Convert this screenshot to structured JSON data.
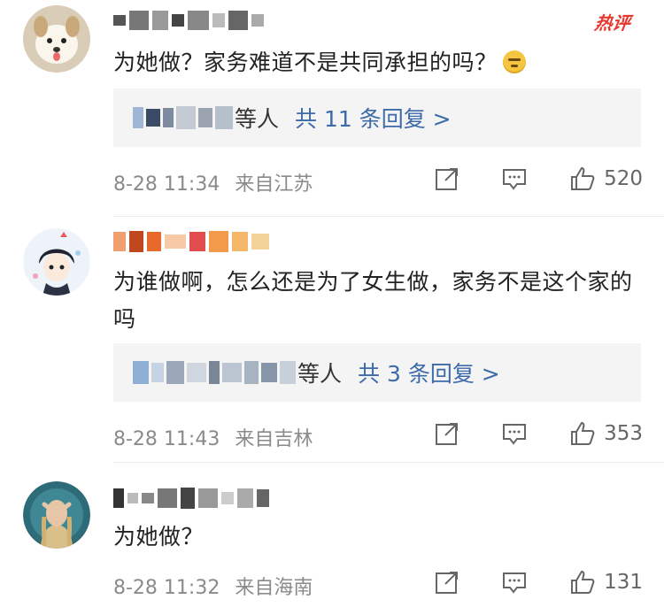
{
  "hot_badge": "热评",
  "comments": [
    {
      "text": "为她做？家务难道不是共同承担的吗？",
      "reply_who": "等人",
      "reply_link": "共 11 条回复 >",
      "time": "8-28 11:34",
      "source": "来自江苏",
      "likes": "520",
      "has_emoji": true,
      "emoji_name": "speechless-emoji"
    },
    {
      "text": "为谁做啊，怎么还是为了女生做，家务不是这个家的吗",
      "reply_who": "等人",
      "reply_link": "共 3 条回复 >",
      "time": "8-28 11:43",
      "source": "来自吉林",
      "likes": "353"
    },
    {
      "text": "为她做？",
      "time": "8-28 11:32",
      "source": "来自海南",
      "likes": "131"
    }
  ],
  "colors": {
    "link": "#3d6aa8",
    "hot": "#e8362e",
    "meta": "#8a8a8a",
    "reply_bg": "#f4f4f4"
  },
  "icons": [
    "repost-icon",
    "comment-icon",
    "like-icon"
  ]
}
